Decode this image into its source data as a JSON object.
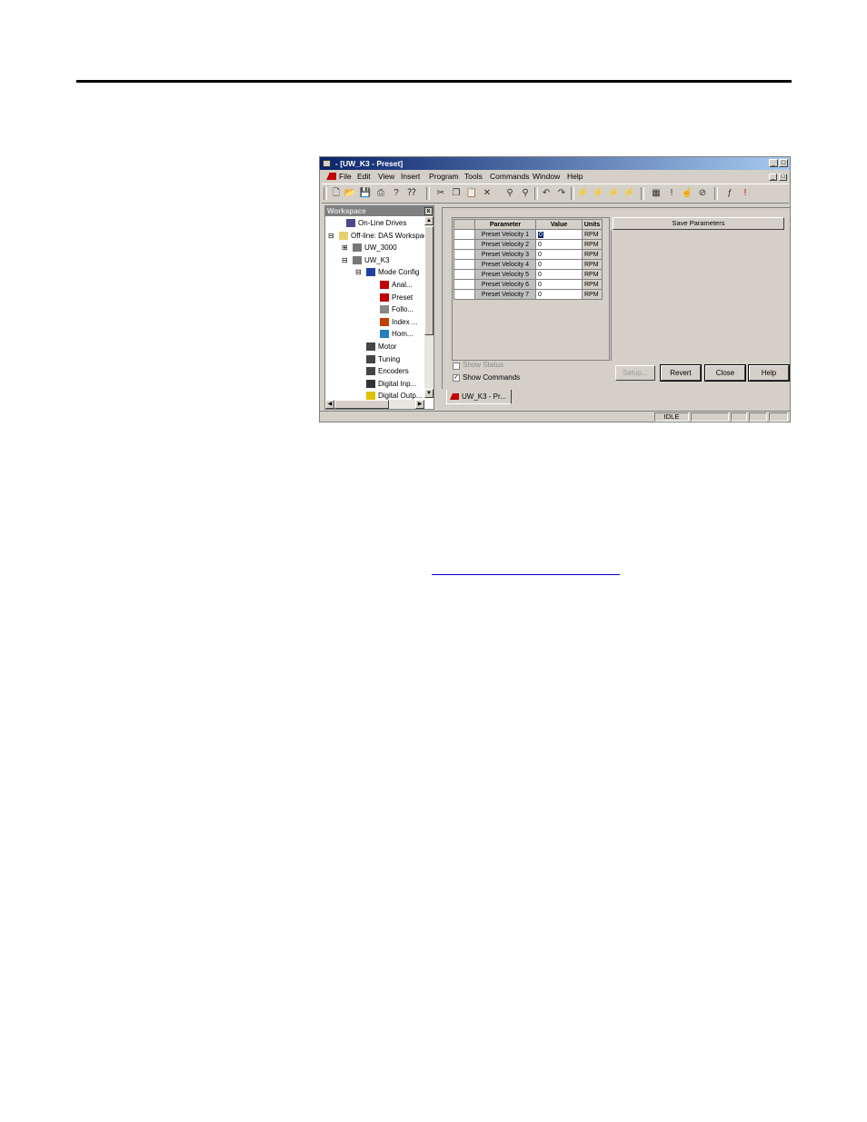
{
  "window": {
    "title": " - [UW_K3 - Preset]",
    "minimize": "_",
    "restore": "□",
    "close": "×"
  },
  "menu": {
    "items": [
      "File",
      "Edit",
      "View",
      "Insert",
      "Program",
      "Tools",
      "Commands",
      "Window",
      "Help"
    ],
    "mdi_minimize": "_",
    "mdi_restore": "□"
  },
  "toolbar": {
    "icons": [
      "new-icon",
      "open-icon",
      "save-icon",
      "print-icon",
      "help-icon",
      "whats-this-icon",
      "cut-icon",
      "copy-icon",
      "paste-icon",
      "delete-icon",
      "find-icon",
      "replace-icon",
      "undo-icon",
      "redo-icon",
      "connect-icon",
      "upload-icon",
      "download-icon",
      "verify-icon",
      "grid-icon",
      "exclamation-icon",
      "hand-icon",
      "stop-icon",
      "function-icon",
      "alert-icon"
    ]
  },
  "workspace": {
    "title": "Workspace",
    "close": "x",
    "tree": [
      {
        "label": "On-Line Drives",
        "icon": "online-drives-icon",
        "expander": ""
      },
      {
        "label": "Off-line: DAS Workspace",
        "icon": "folder-icon",
        "expander": "⊟"
      },
      {
        "label": "UW_3000",
        "icon": "drive-icon",
        "expander": "⊞"
      },
      {
        "label": "UW_K3",
        "icon": "drive-icon",
        "expander": "⊟"
      },
      {
        "label": "Mode Config",
        "icon": "mode-config-icon",
        "expander": "⊟"
      },
      {
        "label": "Anal...",
        "icon": "analog-icon",
        "expander": ""
      },
      {
        "label": "Preset",
        "icon": "preset-icon",
        "expander": ""
      },
      {
        "label": "Follo...",
        "icon": "follower-icon",
        "expander": ""
      },
      {
        "label": "Index ...",
        "icon": "index-icon",
        "expander": ""
      },
      {
        "label": "Hom...",
        "icon": "home-icon",
        "expander": ""
      },
      {
        "label": "Motor",
        "icon": "motor-icon",
        "expander": ""
      },
      {
        "label": "Tuning",
        "icon": "tuning-icon",
        "expander": ""
      },
      {
        "label": "Encoders",
        "icon": "encoders-icon",
        "expander": ""
      },
      {
        "label": "Digital Inp...",
        "icon": "digital-input-icon",
        "expander": ""
      },
      {
        "label": "Digital Outp...",
        "icon": "digital-output-icon",
        "expander": ""
      }
    ]
  },
  "params": {
    "headers": [
      "Parameter",
      "Value",
      "Units"
    ],
    "rows": [
      {
        "name": "Preset Velocity 1",
        "value": "0",
        "unit": "RPM"
      },
      {
        "name": "Preset Velocity 2",
        "value": "0",
        "unit": "RPM"
      },
      {
        "name": "Preset Velocity 3",
        "value": "0",
        "unit": "RPM"
      },
      {
        "name": "Preset Velocity 4",
        "value": "0",
        "unit": "RPM"
      },
      {
        "name": "Preset Velocity 5",
        "value": "0",
        "unit": "RPM"
      },
      {
        "name": "Preset Velocity 6",
        "value": "0",
        "unit": "RPM"
      },
      {
        "name": "Preset Velocity 7",
        "value": "0",
        "unit": "RPM"
      }
    ]
  },
  "panel": {
    "save_label": "Save Parameters",
    "show_status": {
      "label": "Show Status",
      "checked": false
    },
    "show_commands": {
      "label": "Show Commands",
      "checked": true,
      "mark": "✓"
    },
    "buttons": {
      "setup": "Setup...",
      "revert": "Revert",
      "close": "Close",
      "help": "Help"
    }
  },
  "tab": {
    "label": "UW_K3 - Pr..."
  },
  "status": {
    "state": "IDLE"
  }
}
